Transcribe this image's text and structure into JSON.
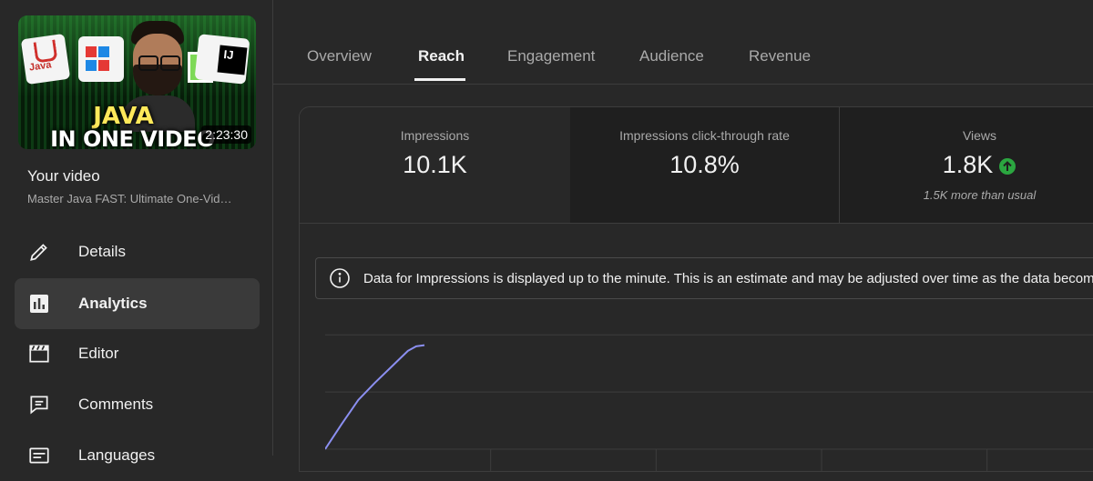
{
  "sidebar": {
    "thumbnail": {
      "text_line1": "JAVA",
      "text_line2": "IN ONE VIDEO",
      "java_logo_text": "Java",
      "ide_logo_text": "IJ",
      "duration": "2:23:30"
    },
    "your_video_label": "Your video",
    "video_title": "Master Java FAST: Ultimate One-Vid…",
    "items": [
      {
        "label": "Details",
        "icon": "pencil-icon",
        "active": false
      },
      {
        "label": "Analytics",
        "icon": "analytics-icon",
        "active": true
      },
      {
        "label": "Editor",
        "icon": "clapperboard-icon",
        "active": false
      },
      {
        "label": "Comments",
        "icon": "comment-icon",
        "active": false
      },
      {
        "label": "Languages",
        "icon": "languages-icon",
        "active": false
      }
    ]
  },
  "tabs": [
    {
      "label": "Overview",
      "active": false
    },
    {
      "label": "Reach",
      "active": true
    },
    {
      "label": "Engagement",
      "active": false
    },
    {
      "label": "Audience",
      "active": false
    },
    {
      "label": "Revenue",
      "active": false
    }
  ],
  "metrics": [
    {
      "label": "Impressions",
      "value": "10.1K",
      "sub": ""
    },
    {
      "label": "Impressions click-through rate",
      "value": "10.8%",
      "sub": ""
    },
    {
      "label": "Views",
      "value": "1.8K",
      "sub": "1.5K more than usual",
      "trend_icon": "arrow-up-circle-icon"
    }
  ],
  "notice": {
    "text": "Data for Impressions is displayed up to the minute. This is an estimate and may be adjusted over time as the data becom"
  },
  "colors": {
    "background": "#282828",
    "line": "#8b8ff0",
    "trend_up": "#2ba640"
  },
  "chart_data": {
    "type": "line",
    "series": [
      {
        "x": [
          0,
          0.1,
          0.2,
          0.3,
          0.4,
          0.5,
          0.55,
          0.6
        ],
        "values": [
          0,
          0.22,
          0.43,
          0.58,
          0.72,
          0.86,
          0.9,
          0.91
        ]
      }
    ],
    "xlim": [
      0,
      4.8
    ],
    "ylim": [
      0,
      1.05
    ],
    "grid": true
  }
}
